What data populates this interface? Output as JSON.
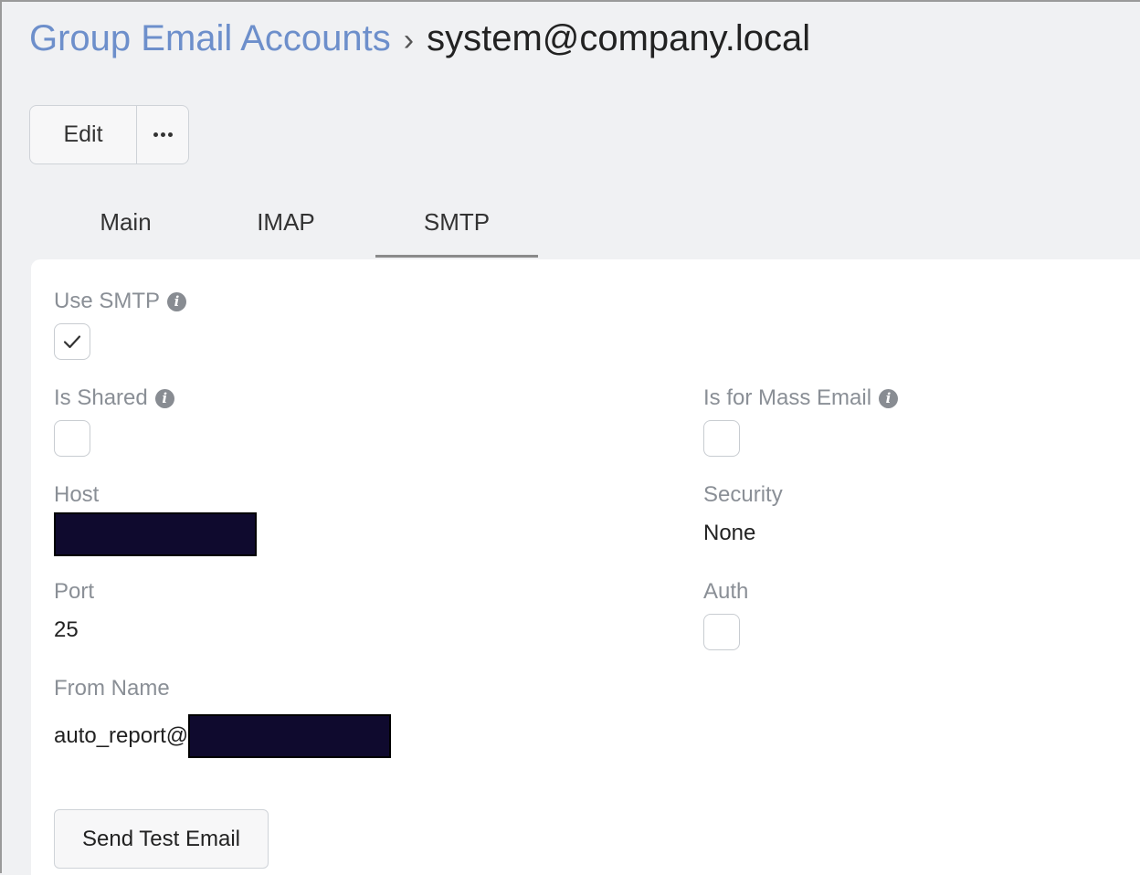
{
  "breadcrumb": {
    "parent": "Group Email Accounts",
    "separator": "›",
    "current": "system@company.local"
  },
  "actions": {
    "edit_label": "Edit",
    "more_icon": "ellipsis-horizontal-icon"
  },
  "tabs": [
    {
      "label": "Main",
      "active": false
    },
    {
      "label": "IMAP",
      "active": false
    },
    {
      "label": "SMTP",
      "active": true
    }
  ],
  "form": {
    "use_smtp": {
      "label": "Use SMTP",
      "checked": true
    },
    "is_shared": {
      "label": "Is Shared",
      "checked": false
    },
    "is_for_mass_email": {
      "label": "Is for Mass Email",
      "checked": false
    },
    "host": {
      "label": "Host",
      "value": "[redacted]"
    },
    "security": {
      "label": "Security",
      "value": "None"
    },
    "port": {
      "label": "Port",
      "value": "25"
    },
    "auth": {
      "label": "Auth",
      "checked": false
    },
    "from_name": {
      "label": "From Name",
      "value_prefix": "auto_report@",
      "value_redacted": true
    }
  },
  "send_test_label": "Send Test Email",
  "colors": {
    "link": "#6d8fcb",
    "redaction": "#0f0a2e",
    "background": "#f0f1f3",
    "panel": "#ffffff"
  }
}
